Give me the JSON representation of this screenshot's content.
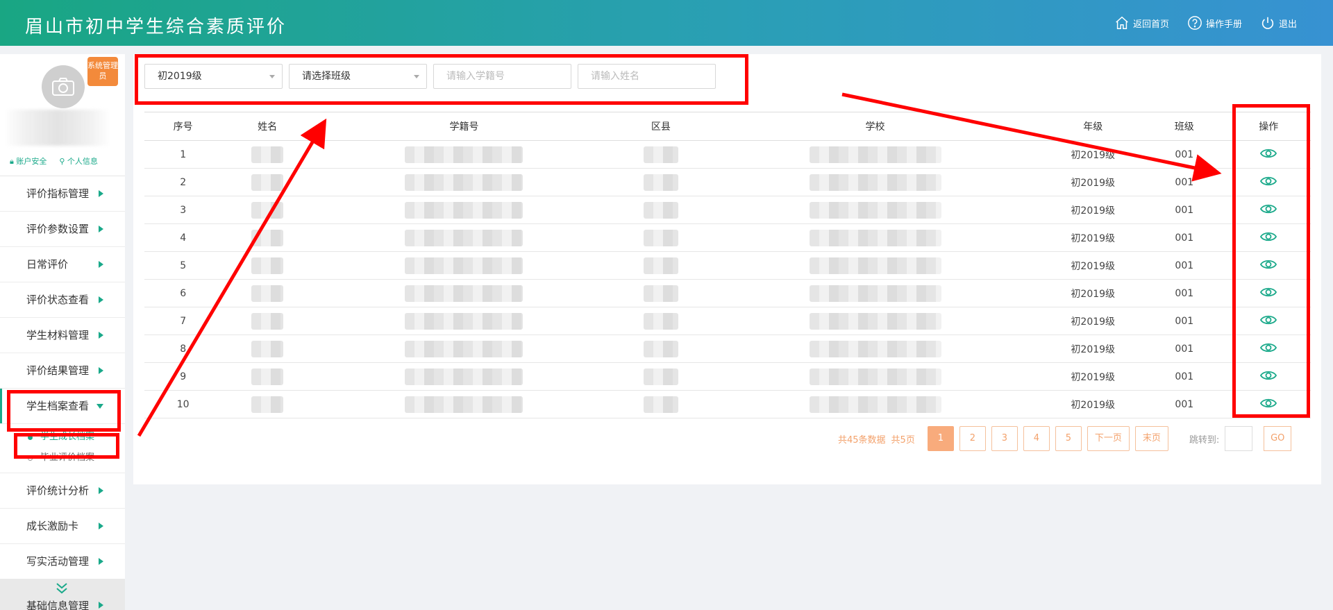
{
  "header": {
    "title": "眉山市初中学生综合素质评价",
    "nav": {
      "home": "返回首页",
      "manual": "操作手册",
      "logout": "退出"
    }
  },
  "profile": {
    "role_badge": "系统管理员",
    "links": {
      "security": "账户安全",
      "info": "个人信息"
    }
  },
  "sidebar": {
    "items": [
      {
        "label": "评价指标管理"
      },
      {
        "label": "评价参数设置"
      },
      {
        "label": "日常评价"
      },
      {
        "label": "评价状态查看"
      },
      {
        "label": "学生材料管理"
      },
      {
        "label": "评价结果管理"
      },
      {
        "label": "学生档案查看"
      },
      {
        "label": "评价统计分析"
      },
      {
        "label": "成长激励卡"
      },
      {
        "label": "写实活动管理"
      },
      {
        "label": "基础信息管理"
      }
    ],
    "sub_items": [
      {
        "label": "学生成长档案"
      },
      {
        "label": "毕业评价档案"
      }
    ]
  },
  "filters": {
    "grade": "初2019级",
    "class_placeholder": "请选择班级",
    "student_no_placeholder": "请输入学籍号",
    "name_placeholder": "请输入姓名"
  },
  "table": {
    "headers": {
      "index": "序号",
      "name": "姓名",
      "student_no": "学籍号",
      "district": "区县",
      "school": "学校",
      "grade": "年级",
      "class": "班级",
      "action": "操作"
    },
    "rows": [
      {
        "index": "1",
        "grade": "初2019级",
        "class": "001"
      },
      {
        "index": "2",
        "grade": "初2019级",
        "class": "001"
      },
      {
        "index": "3",
        "grade": "初2019级",
        "class": "001"
      },
      {
        "index": "4",
        "grade": "初2019级",
        "class": "001"
      },
      {
        "index": "5",
        "grade": "初2019级",
        "class": "001"
      },
      {
        "index": "6",
        "grade": "初2019级",
        "class": "001"
      },
      {
        "index": "7",
        "grade": "初2019级",
        "class": "001"
      },
      {
        "index": "8",
        "grade": "初2019级",
        "class": "001"
      },
      {
        "index": "9",
        "grade": "初2019级",
        "class": "001"
      },
      {
        "index": "10",
        "grade": "初2019级",
        "class": "001"
      }
    ]
  },
  "pager": {
    "total": "共45条数据",
    "pages": "共5页",
    "page_numbers": [
      "1",
      "2",
      "3",
      "4",
      "5"
    ],
    "next": "下一页",
    "last": "末页",
    "jump_label": "跳转到:",
    "go": "GO"
  },
  "colors": {
    "accent": "#1aa98a",
    "pager": "#f3a16b",
    "annotation": "#ff0000"
  }
}
